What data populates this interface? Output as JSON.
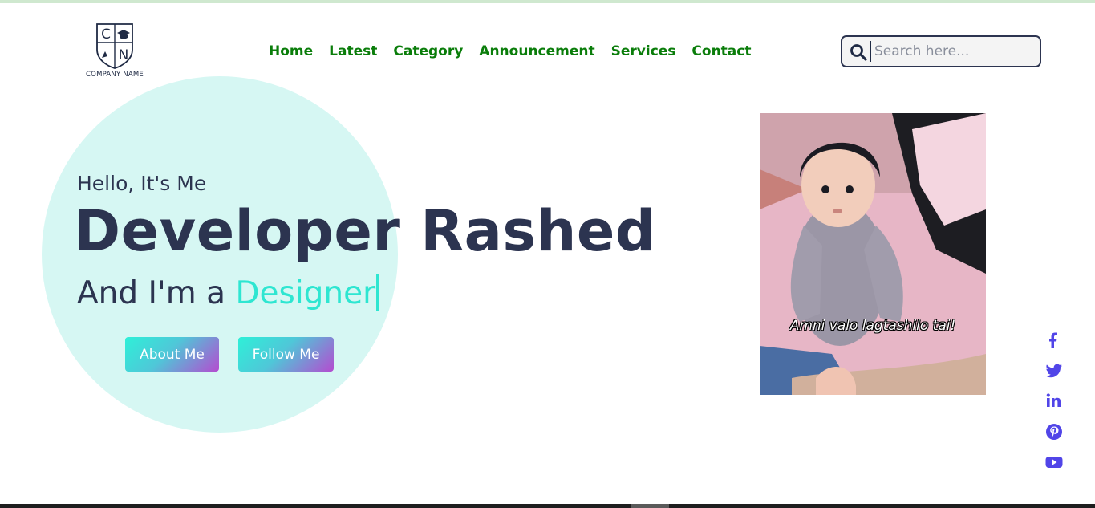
{
  "brand": {
    "logo_letters": [
      "C",
      "N"
    ],
    "company_name": "COMPANY NAME"
  },
  "nav": {
    "items": [
      {
        "label": "Home"
      },
      {
        "label": "Latest"
      },
      {
        "label": "Category"
      },
      {
        "label": "Announcement"
      },
      {
        "label": "Services"
      },
      {
        "label": "Contact"
      }
    ]
  },
  "search": {
    "placeholder": "Search here...",
    "value": "",
    "icon": "search-icon"
  },
  "hero": {
    "greeting": "Hello, It's Me",
    "name": "Developer Rashed",
    "role_prefix": "And I'm a",
    "role_highlight": "Designer",
    "buttons": {
      "about": "About Me",
      "follow": "Follow Me"
    }
  },
  "image": {
    "caption": "Amni valo lagtashilo tai!"
  },
  "social": {
    "icons": [
      "facebook-icon",
      "twitter-icon",
      "linkedin-icon",
      "pinterest-icon",
      "youtube-icon"
    ]
  },
  "colors": {
    "nav_text": "#0a7d0a",
    "heading": "#2c3450",
    "accent": "#2ee6d1",
    "circle_bg": "#d6f7f3",
    "social": "#5145e8",
    "button_gradient": [
      "#2ef0d8",
      "#b54bd0"
    ]
  }
}
